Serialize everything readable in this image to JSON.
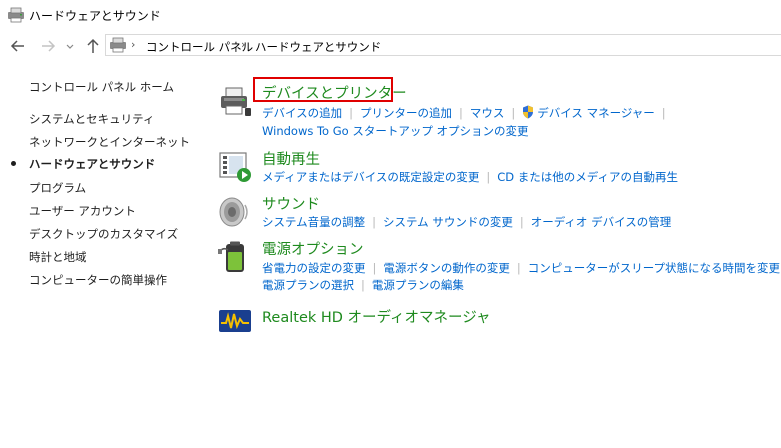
{
  "window": {
    "title": "ハードウェアとサウンド"
  },
  "nav": {
    "breadcrumbs": [
      "コントロール パネル",
      "ハードウェアとサウンド"
    ]
  },
  "sidebar": {
    "home": "コントロール パネル ホーム",
    "items": [
      {
        "label": "システムとセキュリティ",
        "active": false
      },
      {
        "label": "ネットワークとインターネット",
        "active": false
      },
      {
        "label": "ハードウェアとサウンド",
        "active": true
      },
      {
        "label": "プログラム",
        "active": false
      },
      {
        "label": "ユーザー アカウント",
        "active": false
      },
      {
        "label": "デスクトップのカスタマイズ",
        "active": false
      },
      {
        "label": "時計と地域",
        "active": false
      },
      {
        "label": "コンピューターの簡単操作",
        "active": false
      }
    ]
  },
  "categories": [
    {
      "title": "デバイスとプリンター",
      "icon": "printer-icon",
      "lines": [
        [
          "デバイスの追加",
          "プリンターの追加",
          "マウス",
          "デバイス マネージャー"
        ],
        [
          "Windows To Go スタートアップ オプションの変更"
        ]
      ]
    },
    {
      "title": "自動再生",
      "icon": "autoplay-icon",
      "lines": [
        [
          "メディアまたはデバイスの既定設定の変更",
          "CD または他のメディアの自動再生"
        ]
      ]
    },
    {
      "title": "サウンド",
      "icon": "speaker-icon",
      "lines": [
        [
          "システム音量の調整",
          "システム サウンドの変更",
          "オーディオ デバイスの管理"
        ]
      ]
    },
    {
      "title": "電源オプション",
      "icon": "battery-icon",
      "lines": [
        [
          "省電力の設定の変更",
          "電源ボタンの動作の変更",
          "コンピューターがスリープ状態になる時間を変更"
        ],
        [
          "電源プランの選択",
          "電源プランの編集"
        ]
      ]
    },
    {
      "title": "Realtek HD オーディオマネージャ",
      "icon": "realtek-audio-icon",
      "lines": []
    }
  ],
  "colors": {
    "link": "#0066cc",
    "category_title": "#1e8a1e",
    "highlight_box": "#e00000"
  }
}
